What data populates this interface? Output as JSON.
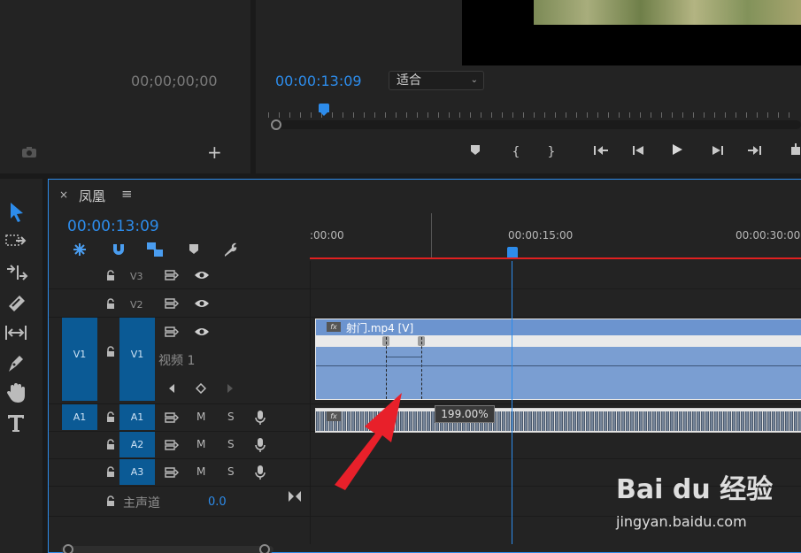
{
  "source_monitor": {
    "timecode": "00;00;00;00",
    "add_label": "+"
  },
  "program_monitor": {
    "timecode": "00:00:13:09",
    "fit_dropdown": "适合"
  },
  "timeline": {
    "sequence_name": "凤凰",
    "close_label": "×",
    "menu_label": "≡",
    "timecode": "00:00:13:09",
    "ruler_labels": [
      ":00:00",
      "00:00:15:00",
      "00:00:30:00"
    ],
    "tracks": {
      "v3": "V3",
      "v2": "V2",
      "v1_source": "V1",
      "v1": "V1",
      "v1_name": "视频 1",
      "a1_source": "A1",
      "a1": "A1",
      "a2": "A2",
      "a3": "A3",
      "mute": "M",
      "solo": "S",
      "master": "主声道",
      "master_value": "0.0"
    },
    "video_clip_name": "射门.mp4 [V]",
    "fx_badge": "fx",
    "tooltip_value": "199.00%"
  },
  "watermark": {
    "logo": "Bai du 经验",
    "url": "jingyan.baidu.com"
  },
  "colors": {
    "accent": "#2d8ceb",
    "track_blue": "#0b5a95",
    "clip_blue": "#7a9ed2",
    "arrow_red": "#e8202a"
  }
}
